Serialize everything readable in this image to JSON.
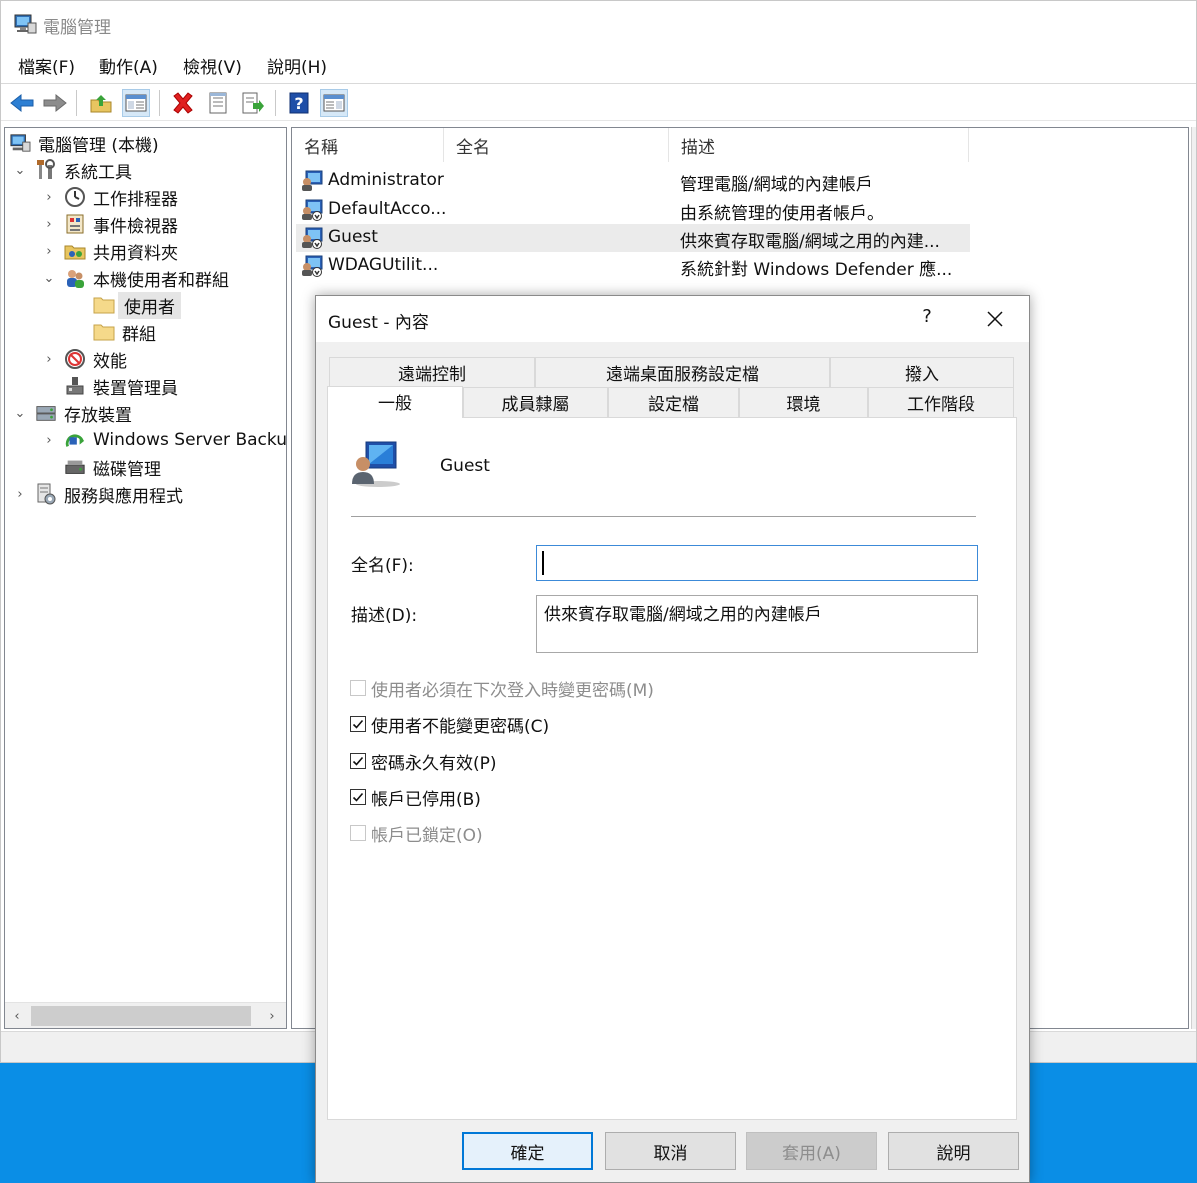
{
  "window": {
    "title": "電腦管理"
  },
  "menu": [
    "檔案(F)",
    "動作(A)",
    "檢視(V)",
    "說明(H)"
  ],
  "toolbar": {
    "icons": [
      "back-arrow-icon",
      "forward-arrow-icon",
      "up-folder-icon",
      "show-hide-tree-icon",
      "delete-icon",
      "properties-icon",
      "export-list-icon",
      "help-icon",
      "action-pane-icon"
    ]
  },
  "tree": {
    "items": [
      {
        "label": "電腦管理 (本機)",
        "icon": "computer-management-icon",
        "expander": ""
      },
      {
        "label": "系統工具",
        "icon": "system-tools-icon",
        "expander": "⌄"
      },
      {
        "label": "工作排程器",
        "icon": "clock-icon",
        "expander": "›"
      },
      {
        "label": "事件檢視器",
        "icon": "event-viewer-icon",
        "expander": "›"
      },
      {
        "label": "共用資料夾",
        "icon": "shared-folder-icon",
        "expander": "›"
      },
      {
        "label": "本機使用者和群組",
        "icon": "users-groups-icon",
        "expander": "⌄"
      },
      {
        "label": "使用者",
        "icon": "folder-icon",
        "expander": ""
      },
      {
        "label": "群組",
        "icon": "folder-icon",
        "expander": ""
      },
      {
        "label": "效能",
        "icon": "performance-icon",
        "expander": "›"
      },
      {
        "label": "裝置管理員",
        "icon": "device-manager-icon",
        "expander": ""
      },
      {
        "label": "存放裝置",
        "icon": "storage-icon",
        "expander": "⌄"
      },
      {
        "label": "Windows Server Backup",
        "icon": "backup-icon",
        "expander": "›"
      },
      {
        "label": "磁碟管理",
        "icon": "disk-management-icon",
        "expander": ""
      },
      {
        "label": "服務與應用程式",
        "icon": "services-icon",
        "expander": "›"
      }
    ]
  },
  "list": {
    "columns": [
      "名稱",
      "全名",
      "描述"
    ],
    "rows": [
      {
        "name": "Administrator",
        "fullname": "",
        "desc": "管理電腦/網域的內建帳戶"
      },
      {
        "name": "DefaultAcco...",
        "fullname": "",
        "desc": "由系統管理的使用者帳戶。"
      },
      {
        "name": "Guest",
        "fullname": "",
        "desc": "供來賓存取電腦/網域之用的內建..."
      },
      {
        "name": "WDAGUtilit...",
        "fullname": "",
        "desc": "系統針對 Windows Defender 應..."
      }
    ]
  },
  "dialog": {
    "title": "Guest - 內容",
    "help": "?",
    "tabs_row1": [
      "遠端控制",
      "遠端桌面服務設定檔",
      "撥入"
    ],
    "tabs_row2": [
      "一般",
      "成員隸屬",
      "設定檔",
      "環境",
      "工作階段"
    ],
    "user_name": "Guest",
    "fullname_label": "全名(F):",
    "fullname_value": "",
    "desc_label": "描述(D):",
    "desc_value": "供來賓存取電腦/網域之用的內建帳戶",
    "checkboxes": [
      {
        "label": "使用者必須在下次登入時變更密碼(M)",
        "checked": false,
        "disabled": true
      },
      {
        "label": "使用者不能變更密碼(C)",
        "checked": true,
        "disabled": false
      },
      {
        "label": "密碼永久有效(P)",
        "checked": true,
        "disabled": false
      },
      {
        "label": "帳戶已停用(B)",
        "checked": true,
        "disabled": false
      },
      {
        "label": "帳戶已鎖定(O)",
        "checked": false,
        "disabled": true
      }
    ],
    "buttons": {
      "ok": "確定",
      "cancel": "取消",
      "apply": "套用(A)",
      "help": "說明"
    }
  },
  "colors": {
    "desktop": "#0a8ee6",
    "accent": "#0078d7"
  }
}
